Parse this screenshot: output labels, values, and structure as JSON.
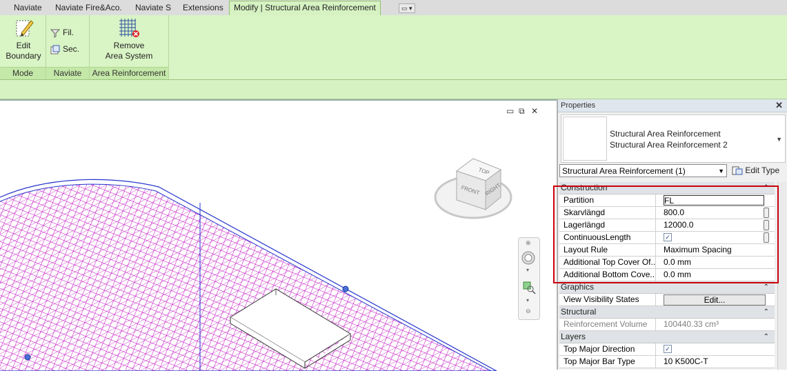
{
  "tabs": [
    "Naviate",
    "Naviate Fire&Aco.",
    "Naviate S",
    "Extensions",
    "Modify | Structural Area Reinforcement"
  ],
  "ribbon": {
    "mode": {
      "edit_label_1": "Edit",
      "edit_label_2": "Boundary",
      "title": "Mode"
    },
    "naviate": {
      "fil": "Fil.",
      "sec": "Sec.",
      "title": "Naviate"
    },
    "area": {
      "remove_1": "Remove",
      "remove_2": "Area System",
      "title": "Area Reinforcement"
    }
  },
  "viewcube": {
    "top": "TOP",
    "front": "FRONT",
    "right": "RIGHT"
  },
  "properties": {
    "title": "Properties",
    "type_line1": "Structural Area Reinforcement",
    "type_line2": "Structural Area Reinforcement 2",
    "selector": "Structural Area Reinforcement (1)",
    "edit_type": "Edit Type",
    "groups": {
      "construction": "Construction",
      "graphics": "Graphics",
      "structural": "Structural",
      "layers": "Layers"
    },
    "rows": {
      "partition": {
        "k": "Partition",
        "v": "FL"
      },
      "skarv": {
        "k": "Skarvlängd",
        "v": "800.0"
      },
      "lager": {
        "k": "Lagerlängd",
        "v": "12000.0"
      },
      "continuous": {
        "k": "ContinuousLength"
      },
      "layout": {
        "k": "Layout Rule",
        "v": "Maximum Spacing"
      },
      "topcover": {
        "k": "Additional Top Cover Of...",
        "v": "0.0 mm"
      },
      "bottomcover": {
        "k": "Additional Bottom Cove...",
        "v": "0.0 mm"
      },
      "vis": {
        "k": "View Visibility States",
        "v": "Edit..."
      },
      "volume": {
        "k": "Reinforcement Volume",
        "v": "100440.33 cm³"
      },
      "topdir": {
        "k": "Top Major Direction"
      },
      "topbar": {
        "k": "Top Major Bar Type",
        "v": "10 K500C-T"
      }
    }
  },
  "colors": {
    "ribbon": "#d9f4c5",
    "rebar": "#c000c0",
    "edge": "#2233cc",
    "highlight": "#c8000a"
  }
}
